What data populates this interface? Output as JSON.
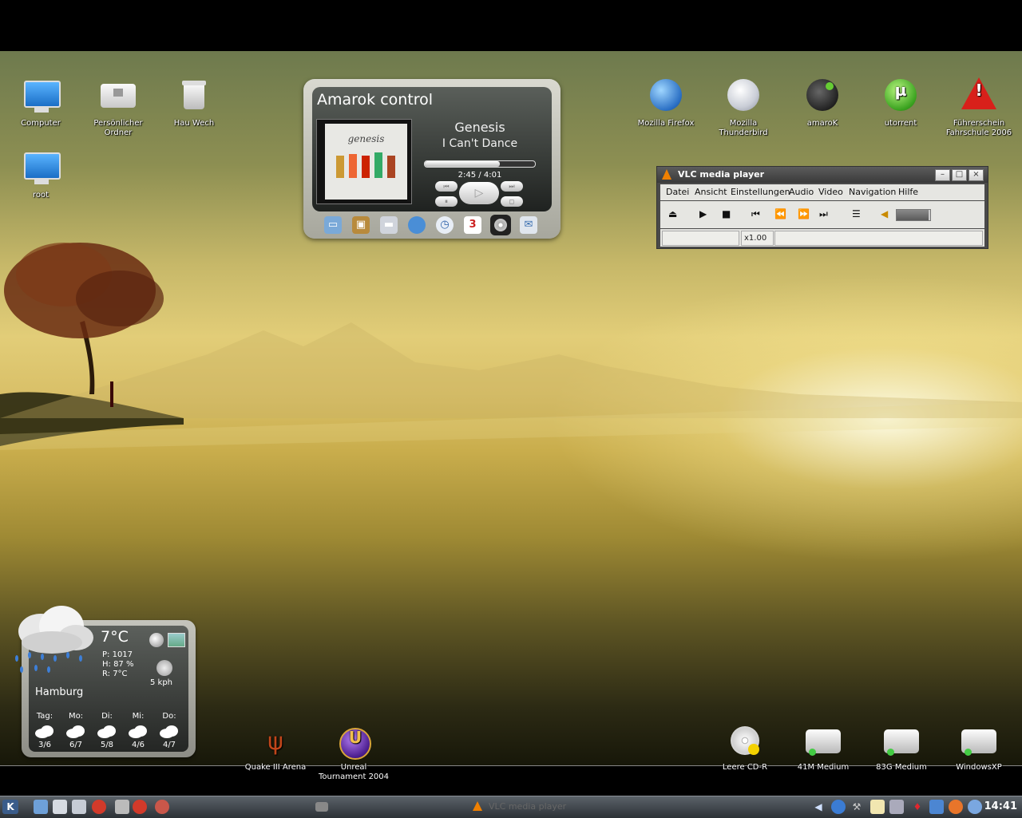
{
  "desktop": {
    "icons_left": [
      {
        "label": "Computer",
        "icon": "computer-monitor-icon"
      },
      {
        "label": "Persönlicher Ordner",
        "icon": "home-folder-icon"
      },
      {
        "label": "Hau Wech",
        "icon": "trash-icon"
      },
      {
        "label": "root",
        "icon": "computer-monitor-icon"
      }
    ],
    "icons_right": [
      {
        "label": "Mozilla Firefox",
        "icon": "firefox-icon"
      },
      {
        "label": "Mozilla Thunderbird",
        "icon": "thunderbird-icon"
      },
      {
        "label": "amaroK",
        "icon": "amarok-icon"
      },
      {
        "label": "utorrent",
        "icon": "utorrent-icon"
      },
      {
        "label": "Führerschein Fahrschule 2006",
        "icon": "warning-icon"
      }
    ],
    "icons_bottom": [
      {
        "label": "Quake III Arena",
        "icon": "quake-icon"
      },
      {
        "label": "Unreal Tournament 2004",
        "icon": "unreal-icon"
      },
      {
        "label": "Leere CD-R",
        "icon": "cd-icon"
      },
      {
        "label": "41M Medium",
        "icon": "drive-icon"
      },
      {
        "label": "83G Medium",
        "icon": "drive-icon"
      },
      {
        "label": "WindowsXP",
        "icon": "drive-icon"
      }
    ]
  },
  "amarok": {
    "title": "Amarok control",
    "album_art_text": "genesis",
    "artist": "Genesis",
    "track": "I Can't Dance",
    "time": "2:45 / 4:01",
    "progress": 0.68
  },
  "vlc": {
    "title": "VLC media player",
    "menus": [
      "Datei",
      "Ansicht",
      "Einstellungen",
      "Audio",
      "Video",
      "Navigation",
      "Hilfe"
    ],
    "speed": "x1.00",
    "volume": 0.95
  },
  "weather": {
    "temperature": "7°C",
    "pressure": "P: 1017",
    "humidity": "H: 87 %",
    "realfeel": "R: 7°C",
    "wind": "5 kph",
    "city": "Hamburg",
    "forecast": [
      {
        "day": "Tag:",
        "temps": "3/6"
      },
      {
        "day": "Mo:",
        "temps": "6/7"
      },
      {
        "day": "Di:",
        "temps": "5/8"
      },
      {
        "day": "Mi:",
        "temps": "4/6"
      },
      {
        "day": "Do:",
        "temps": "4/7"
      }
    ]
  },
  "taskbar": {
    "task_title": "VLC media player",
    "clock": "14:41"
  }
}
